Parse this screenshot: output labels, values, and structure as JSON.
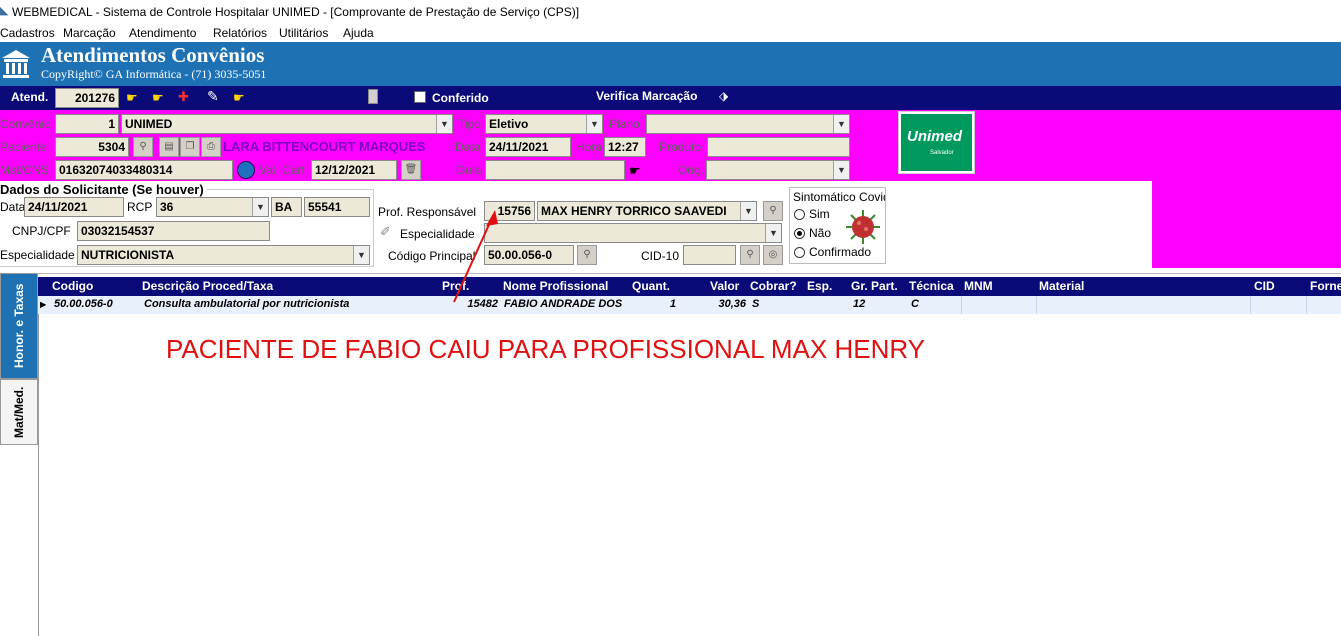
{
  "window": {
    "title": "WEBMEDICAL - Sistema de Controle Hospitalar UNIMED - [Comprovante de Prestação de Serviço  (CPS)]"
  },
  "menu": [
    "Cadastros",
    "Marcação",
    "Atendimento",
    "Relatórios",
    "Utilitários",
    "Ajuda"
  ],
  "banner": {
    "title": "Atendimentos Convênios",
    "copyright": "CopyRight© GA Informática - (71) 3035-5051"
  },
  "toolbar": {
    "atend_label": "Atend.",
    "atend_value": "201276",
    "conferido_label": "Conferido",
    "verifica_label": "Verifica Marcação"
  },
  "form": {
    "convenio_label": "Convênio",
    "convenio_code": "1",
    "convenio_name": "UNIMED",
    "tipo_label": "Tipo",
    "tipo_value": "Eletivo",
    "plano_label": "Plano",
    "plano_value": "",
    "paciente_label": "Paciente",
    "paciente_code": "5304",
    "paciente_name": "LARA BITTENCOURT MARQUES",
    "data_label": "Data",
    "data_value": "24/11/2021",
    "hora_label": "Hora",
    "hora_value": "12:27",
    "produto_label": "Produto",
    "produto_value": "",
    "matcns_label": "Mat/CNS",
    "matcns_value": "01632074033480314",
    "valcart_label": "Val. Cart",
    "valcart_value": "12/12/2021",
    "guia_label": "Guia",
    "guia_value": "",
    "orig_label": "Orig.",
    "orig_value": ""
  },
  "unimed_logo": {
    "brand": "Unimed",
    "sub": "Salvador"
  },
  "solicitante": {
    "heading": "Dados do Solicitante (Se houver)",
    "data_label": "Data",
    "data_value": "24/11/2021",
    "rcp_label": "RCP",
    "rcp_value": "36",
    "uf_value": "BA",
    "crm_value": "55541",
    "cnpj_label": "CNPJ/CPF",
    "cnpj_value": "03032154537",
    "esp_label": "Especialidade",
    "esp_value": "NUTRICIONISTA"
  },
  "responsavel": {
    "prof_label": "Prof. Responsável",
    "prof_code": "15756",
    "prof_name": "MAX HENRY TORRICO SAAVEDI",
    "esp_label": "Especialidade",
    "esp_value": "",
    "codigo_label": "Código Principal",
    "codigo_value": "50.00.056-0",
    "cid_label": "CID-10",
    "cid_value": ""
  },
  "covid": {
    "title": "Sintomático Covid",
    "options": [
      "Sim",
      "Não",
      "Confirmado"
    ],
    "selected": "Não"
  },
  "tabs": [
    "Honor. e Taxas",
    "Mat/Med."
  ],
  "grid": {
    "columns": [
      "Codigo",
      "Descrição Proced/Taxa",
      "Prof.",
      "Nome Profissional",
      "Quant.",
      "Valor",
      "Cobrar?",
      "Esp.",
      "Gr. Part.",
      "Técnica",
      "MNM",
      "Material",
      "CID",
      "Forne"
    ],
    "rows": [
      {
        "codigo": "50.00.056-0",
        "descricao": "Consulta ambulatorial por nutricionista",
        "prof": "15482",
        "nome": "FABIO ANDRADE DOS",
        "quant": "1",
        "valor": "30,36",
        "cobrar": "S",
        "esp": "",
        "grpart": "12",
        "tecnica": "C"
      }
    ]
  },
  "annotation": {
    "text": "PACIENTE DE FABIO CAIU PARA PROFISSIONAL MAX HENRY",
    "color": "#e01010"
  },
  "colors": {
    "banner": "#1e72b4",
    "magenta": "#ff00ff",
    "navy": "#0a0a78",
    "purple_text": "#8000c0"
  }
}
